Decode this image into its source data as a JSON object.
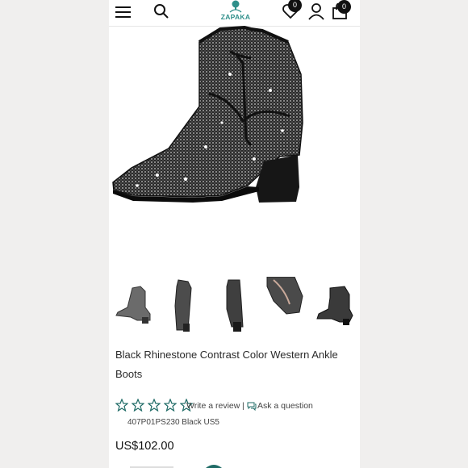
{
  "header": {
    "brand": "ZAPAKA",
    "icons": [
      "menu-icon",
      "search-icon",
      "heart-icon",
      "user-icon",
      "bag-icon"
    ],
    "wishlist_count": "0",
    "cart_count": "0"
  },
  "product": {
    "title": "Black Rhinestone Contrast Color Western Ankle Boots",
    "rating": 0,
    "rating_max": 5,
    "write_review": "Write a review",
    "separator": "|",
    "ask_question": "Ask a question",
    "sku": "407P01PS230 Black US5",
    "price": "US$102.00"
  },
  "gallery": {
    "thumbnail_count": 5
  },
  "colors": {
    "brand": "#2f8f8a",
    "text": "#2b2b2b",
    "star_outline": "#1f6b66"
  }
}
